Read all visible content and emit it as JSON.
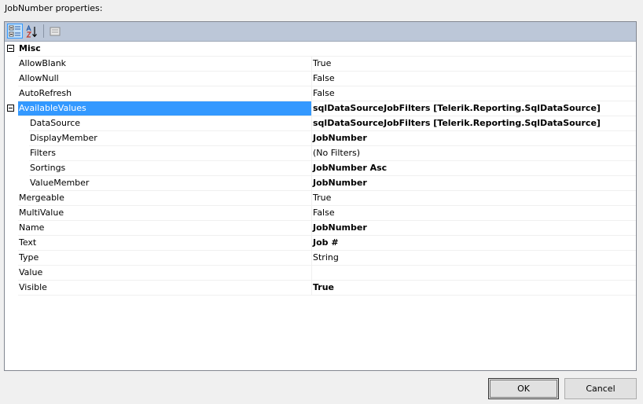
{
  "dialog": {
    "title": "JobNumber properties:"
  },
  "toolbar": {
    "buttons": [
      {
        "icon": "categorized-icon",
        "pressed": true
      },
      {
        "icon": "alphabetical-sort-icon",
        "pressed": false
      },
      {
        "icon": "property-pages-icon",
        "pressed": false
      }
    ]
  },
  "properties": {
    "category": "Misc",
    "rows": {
      "allow_blank": {
        "name": "AllowBlank",
        "value": "True"
      },
      "allow_null": {
        "name": "AllowNull",
        "value": "False"
      },
      "auto_refresh": {
        "name": "AutoRefresh",
        "value": "False"
      },
      "available_values": {
        "name": "AvailableValues",
        "value": "sqlDataSourceJobFilters [Telerik.Reporting.SqlDataSource]"
      },
      "data_source": {
        "name": "DataSource",
        "value": "sqlDataSourceJobFilters [Telerik.Reporting.SqlDataSource]"
      },
      "display_member": {
        "name": "DisplayMember",
        "value": "JobNumber"
      },
      "filters": {
        "name": "Filters",
        "value": "(No Filters)"
      },
      "sortings": {
        "name": "Sortings",
        "value": "JobNumber Asc"
      },
      "value_member": {
        "name": "ValueMember",
        "value": "JobNumber"
      },
      "mergeable": {
        "name": "Mergeable",
        "value": "True"
      },
      "multi_value": {
        "name": "MultiValue",
        "value": "False"
      },
      "name": {
        "name": "Name",
        "value": "JobNumber"
      },
      "text": {
        "name": "Text",
        "value": "Job #"
      },
      "type": {
        "name": "Type",
        "value": "String"
      },
      "value": {
        "name": "Value",
        "value": ""
      },
      "visible": {
        "name": "Visible",
        "value": "True"
      }
    }
  },
  "buttons": {
    "ok": "OK",
    "cancel": "Cancel"
  },
  "colors": {
    "selection": "#3399ff",
    "toolbar": "#bcc7d8",
    "grid_line": "#f0f0f0"
  }
}
